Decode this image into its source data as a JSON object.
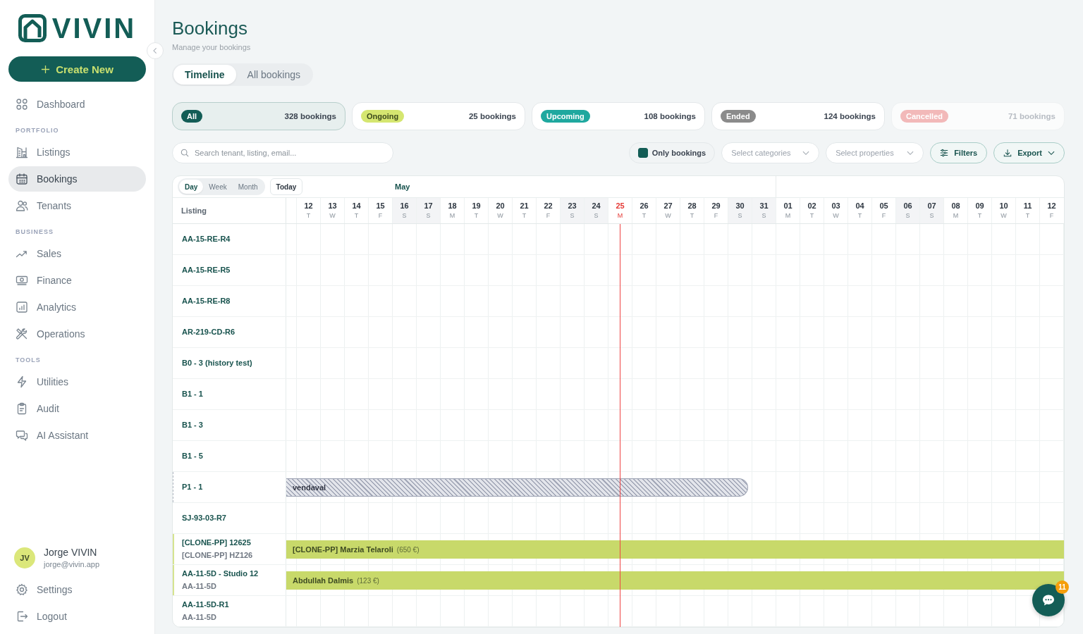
{
  "sidebar": {
    "logo_text": "VIVIN",
    "create_button": {
      "label": "Create New"
    },
    "sections": [
      {
        "items": [
          {
            "label": "Dashboard",
            "selected": false
          }
        ]
      },
      {
        "title": "PORTFOLIO",
        "items": [
          {
            "label": "Listings",
            "selected": false
          },
          {
            "label": "Bookings",
            "selected": true
          },
          {
            "label": "Tenants",
            "selected": false
          }
        ]
      },
      {
        "title": "BUSINESS",
        "items": [
          {
            "label": "Sales",
            "selected": false
          },
          {
            "label": "Finance",
            "selected": false
          },
          {
            "label": "Analytics",
            "selected": false
          },
          {
            "label": "Operations",
            "selected": false
          }
        ]
      },
      {
        "title": "TOOLS",
        "items": [
          {
            "label": "Utilities",
            "selected": false
          },
          {
            "label": "Audit",
            "selected": false
          },
          {
            "label": "AI Assistant",
            "selected": false
          }
        ]
      }
    ],
    "user": {
      "initials": "JV",
      "name": "Jorge VIVIN",
      "email": "jorge@vivin.app"
    },
    "footer_items": [
      {
        "label": "Settings",
        "selected": false
      },
      {
        "label": "Logout",
        "selected": false
      }
    ]
  },
  "page": {
    "title": "Bookings",
    "subtitle": "Manage your bookings"
  },
  "view_tabs": [
    {
      "label": "Timeline",
      "selected": true
    },
    {
      "label": "All bookings",
      "selected": false
    }
  ],
  "status_filters": [
    {
      "label": "All",
      "count": "328 bookings",
      "color": "#135d56",
      "selected": true,
      "disabled": false
    },
    {
      "label": "Ongoing",
      "count": "25 bookings",
      "color": "#d5e670",
      "selected": false,
      "disabled": false
    },
    {
      "label": "Upcoming",
      "count": "108 bookings",
      "color": "#1fa89f",
      "selected": false,
      "disabled": false
    },
    {
      "label": "Ended",
      "count": "124 bookings",
      "color": "#8b8b8b",
      "selected": false,
      "disabled": false
    },
    {
      "label": "Cancelled",
      "count": "71 bookings",
      "color": "#f2b9b9",
      "selected": false,
      "disabled": true
    }
  ],
  "toolbar": {
    "search": {
      "placeholder": "Search tenant, listing, email..."
    },
    "only_bookings": {
      "label": "Only bookings",
      "checked": true
    },
    "dropdowns": [
      {
        "placeholder": "Select categories"
      },
      {
        "placeholder": "Select properties"
      }
    ],
    "buttons": [
      {
        "label": "Filters",
        "kind": "filters"
      },
      {
        "label": "Export",
        "kind": "export"
      }
    ]
  },
  "timeline": {
    "range_tabs": [
      {
        "label": "Day",
        "selected": true
      },
      {
        "label": "Week",
        "selected": false
      },
      {
        "label": "Month",
        "selected": false
      }
    ],
    "today_button": {
      "label": "Today"
    },
    "listing_header": "Listing",
    "months": [
      {
        "name": "May",
        "days": [
          {
            "day": "12",
            "weekday": "T",
            "weekend": false,
            "today": false
          },
          {
            "day": "13",
            "weekday": "W",
            "weekend": false,
            "today": false
          },
          {
            "day": "14",
            "weekday": "T",
            "weekend": false,
            "today": false
          },
          {
            "day": "15",
            "weekday": "F",
            "weekend": false,
            "today": false
          },
          {
            "day": "16",
            "weekday": "S",
            "weekend": true,
            "today": false
          },
          {
            "day": "17",
            "weekday": "S",
            "weekend": true,
            "today": false
          },
          {
            "day": "18",
            "weekday": "M",
            "weekend": false,
            "today": false
          },
          {
            "day": "19",
            "weekday": "T",
            "weekend": false,
            "today": false
          },
          {
            "day": "20",
            "weekday": "W",
            "weekend": false,
            "today": false
          },
          {
            "day": "21",
            "weekday": "T",
            "weekend": false,
            "today": false
          },
          {
            "day": "22",
            "weekday": "F",
            "weekend": false,
            "today": false
          },
          {
            "day": "23",
            "weekday": "S",
            "weekend": true,
            "today": false
          },
          {
            "day": "24",
            "weekday": "S",
            "weekend": true,
            "today": false
          },
          {
            "day": "25",
            "weekday": "M",
            "weekend": false,
            "today": true
          },
          {
            "day": "26",
            "weekday": "T",
            "weekend": false,
            "today": false
          },
          {
            "day": "27",
            "weekday": "W",
            "weekend": false,
            "today": false
          },
          {
            "day": "28",
            "weekday": "T",
            "weekend": false,
            "today": false
          },
          {
            "day": "29",
            "weekday": "F",
            "weekend": false,
            "today": false
          },
          {
            "day": "30",
            "weekday": "S",
            "weekend": true,
            "today": false
          },
          {
            "day": "31",
            "weekday": "S",
            "weekend": true,
            "today": false
          }
        ]
      },
      {
        "days": [
          {
            "day": "01",
            "weekday": "M",
            "weekend": false,
            "today": false
          },
          {
            "day": "02",
            "weekday": "T",
            "weekend": false,
            "today": false
          },
          {
            "day": "03",
            "weekday": "W",
            "weekend": false,
            "today": false
          },
          {
            "day": "04",
            "weekday": "T",
            "weekend": false,
            "today": false
          },
          {
            "day": "05",
            "weekday": "F",
            "weekend": false,
            "today": false
          },
          {
            "day": "06",
            "weekday": "S",
            "weekend": true,
            "today": false
          },
          {
            "day": "07",
            "weekday": "S",
            "weekend": true,
            "today": false
          },
          {
            "day": "08",
            "weekday": "M",
            "weekend": false,
            "today": false
          },
          {
            "day": "09",
            "weekday": "T",
            "weekend": false,
            "today": false
          },
          {
            "day": "10",
            "weekday": "W",
            "weekend": false,
            "today": false
          },
          {
            "day": "11",
            "weekday": "T",
            "weekend": false,
            "today": false
          },
          {
            "day": "12",
            "weekday": "F",
            "weekend": false,
            "today": false
          }
        ]
      }
    ],
    "rows": [
      {
        "name": "AA-15-RE-R4"
      },
      {
        "name": "AA-15-RE-R5"
      },
      {
        "name": "AA-15-RE-R8"
      },
      {
        "name": "AR-219-CD-R6"
      },
      {
        "name": "B0 - 3 (history test)"
      },
      {
        "name": "B1 - 1"
      },
      {
        "name": "B1 - 3"
      },
      {
        "name": "B1 - 5"
      },
      {
        "name": "P1 - 1",
        "bar": {
          "kind": "blocked",
          "label": "vendaval",
          "level": 0.594
        }
      },
      {
        "name": "SJ-93-03-R7"
      },
      {
        "name": "[CLONE-PP] 12625",
        "subtitle": "[CLONE-PP] HZ126",
        "bar": {
          "kind": "booking",
          "label": "[CLONE-PP] Marzia Telaroli",
          "price": "(650 €)",
          "level": 1
        }
      },
      {
        "name": "AA-11-5D - Studio 12",
        "subtitle": "AA-11-5D",
        "bar": {
          "kind": "booking",
          "label": "Abdullah Dalmis",
          "price": "(123 €)",
          "level": 1
        }
      },
      {
        "name": "AA-11-5D-R1",
        "subtitle": "AA-11-5D"
      }
    ]
  },
  "chat": {
    "badge": "11"
  }
}
